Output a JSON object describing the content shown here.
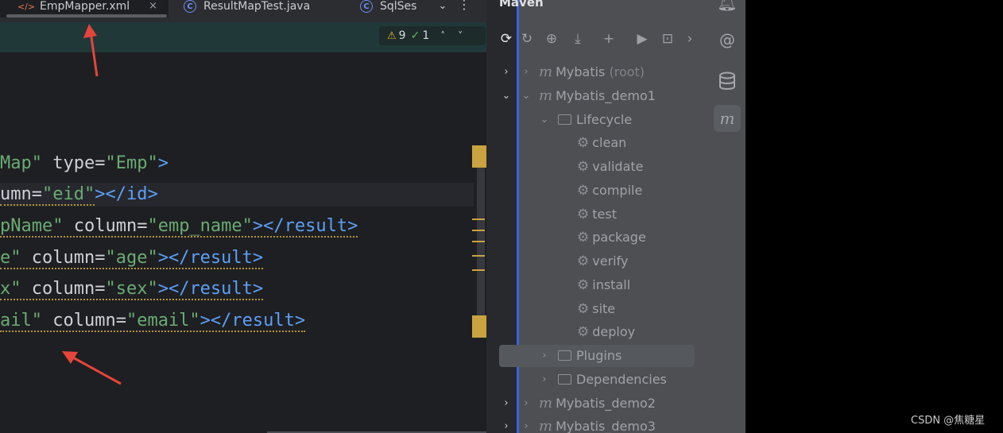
{
  "tabs": [
    {
      "label": "EmpMapper.xml",
      "icon": "xml-icon",
      "active": true,
      "close": "×"
    },
    {
      "label": "ResultMapTest.java",
      "icon": "class-icon"
    },
    {
      "label": "SqlSes",
      "icon": "class-icon"
    }
  ],
  "tab_menu": "⌄",
  "tab_more": "⋮",
  "inspection": {
    "warnings": "9",
    "ok": "1",
    "up": "˄",
    "down": "˅"
  },
  "code_lines": [
    {
      "seg": [
        "Map\"",
        " type=",
        "\"Emp\"",
        ">"
      ]
    },
    {
      "seg": [
        "umn=",
        "\"eid\"",
        "></id>"
      ]
    },
    {
      "seg": [
        "pName\"",
        " column=",
        "\"emp_name\"",
        "></result>"
      ]
    },
    {
      "seg": [
        "e\"",
        " column=",
        "\"age\"",
        "></result>"
      ]
    },
    {
      "seg": [
        "x\"",
        " column=",
        "\"sex\"",
        "></result>"
      ]
    },
    {
      "seg": [
        "ail\"",
        " column=",
        "\"email\"",
        "></result>"
      ]
    }
  ],
  "maven": {
    "title": "Maven",
    "toolbar": [
      "⟳",
      "↻",
      "⊕",
      "⤓",
      "+",
      "▶",
      "⊡",
      "›"
    ],
    "tree": [
      {
        "label": "Mybatis",
        "suffix": "(root)",
        "type": "module"
      },
      {
        "label": "Mybatis_demo1",
        "type": "module"
      },
      {
        "label": "Lifecycle",
        "type": "folder"
      },
      {
        "label": "clean",
        "type": "goal"
      },
      {
        "label": "validate",
        "type": "goal"
      },
      {
        "label": "compile",
        "type": "goal"
      },
      {
        "label": "test",
        "type": "goal"
      },
      {
        "label": "package",
        "type": "goal"
      },
      {
        "label": "verify",
        "type": "goal"
      },
      {
        "label": "install",
        "type": "goal"
      },
      {
        "label": "site",
        "type": "goal"
      },
      {
        "label": "deploy",
        "type": "goal"
      },
      {
        "label": "Plugins",
        "type": "folder"
      },
      {
        "label": "Dependencies",
        "type": "folder"
      },
      {
        "label": "Mybatis_demo2",
        "type": "module"
      },
      {
        "label": "Mybatis_demo3",
        "type": "module"
      }
    ]
  },
  "right_strip": [
    "bell-icon",
    "spiral-icon",
    "database-icon",
    "maven-icon"
  ],
  "watermark": "CSDN @焦糖星",
  "colors": {
    "string": "#6aab73",
    "tag": "#5d9ff6",
    "warning": "#c9a33f",
    "accent_blue": "#3b63e0"
  }
}
